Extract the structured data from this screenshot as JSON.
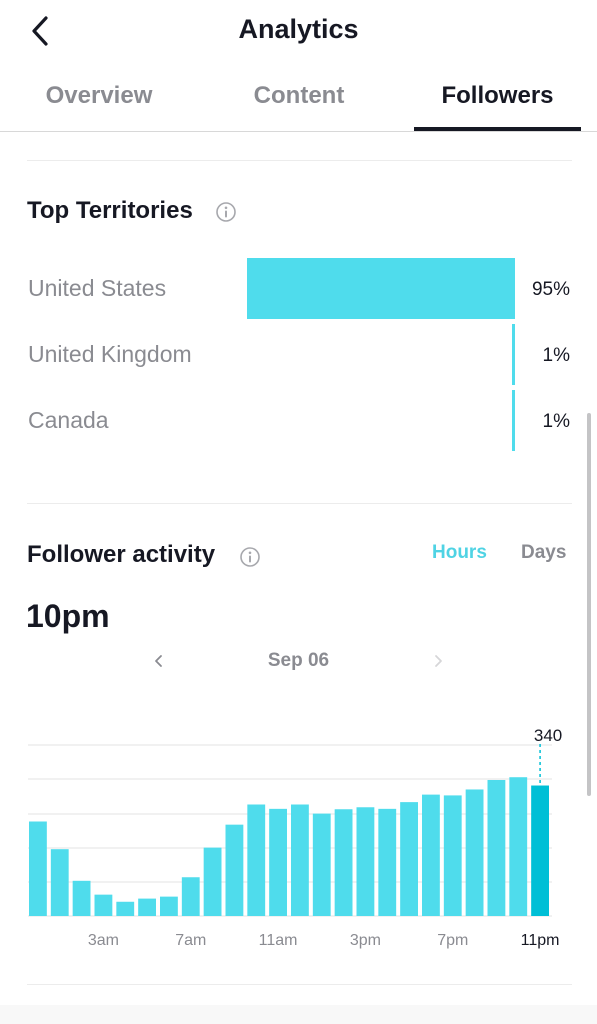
{
  "header": {
    "title": "Analytics"
  },
  "tabs": [
    {
      "label": "Overview",
      "active": false
    },
    {
      "label": "Content",
      "active": false
    },
    {
      "label": "Followers",
      "active": true
    }
  ],
  "top_territories": {
    "title": "Top Territories",
    "items": [
      {
        "name": "United States",
        "label": "95%",
        "percent": 95
      },
      {
        "name": "United Kingdom",
        "label": "1%",
        "percent": 1
      },
      {
        "name": "Canada",
        "label": "1%",
        "percent": 1
      }
    ]
  },
  "follower_activity": {
    "title": "Follower activity",
    "toggle_hours": "Hours",
    "toggle_days": "Days",
    "selected_value": "10pm",
    "date": "Sep 06",
    "highlight_label": "340"
  },
  "colors": {
    "accent": "#4fdcec",
    "accent_selected": "#00bfd6",
    "toggle_active": "#4fd3e4"
  },
  "chart_data": {
    "type": "bar",
    "x": [
      "12am",
      "1am",
      "2am",
      "3am",
      "4am",
      "5am",
      "6am",
      "7am",
      "8am",
      "9am",
      "10am",
      "11am",
      "12pm",
      "1pm",
      "2pm",
      "3pm",
      "4pm",
      "5pm",
      "6pm",
      "7pm",
      "8pm",
      "9pm",
      "10pm",
      "11pm"
    ],
    "tick_labels": [
      "3am",
      "7am",
      "11am",
      "3pm",
      "7pm",
      "11pm"
    ],
    "values": [
      239,
      169,
      89,
      54,
      36,
      44,
      49,
      98,
      173,
      231,
      282,
      271,
      282,
      259,
      270,
      275,
      271,
      288,
      307,
      305,
      320,
      344,
      351,
      330
    ],
    "highlight_index": 23,
    "highlight_label": "340",
    "ylim": [
      0,
      435
    ],
    "grid": true
  }
}
